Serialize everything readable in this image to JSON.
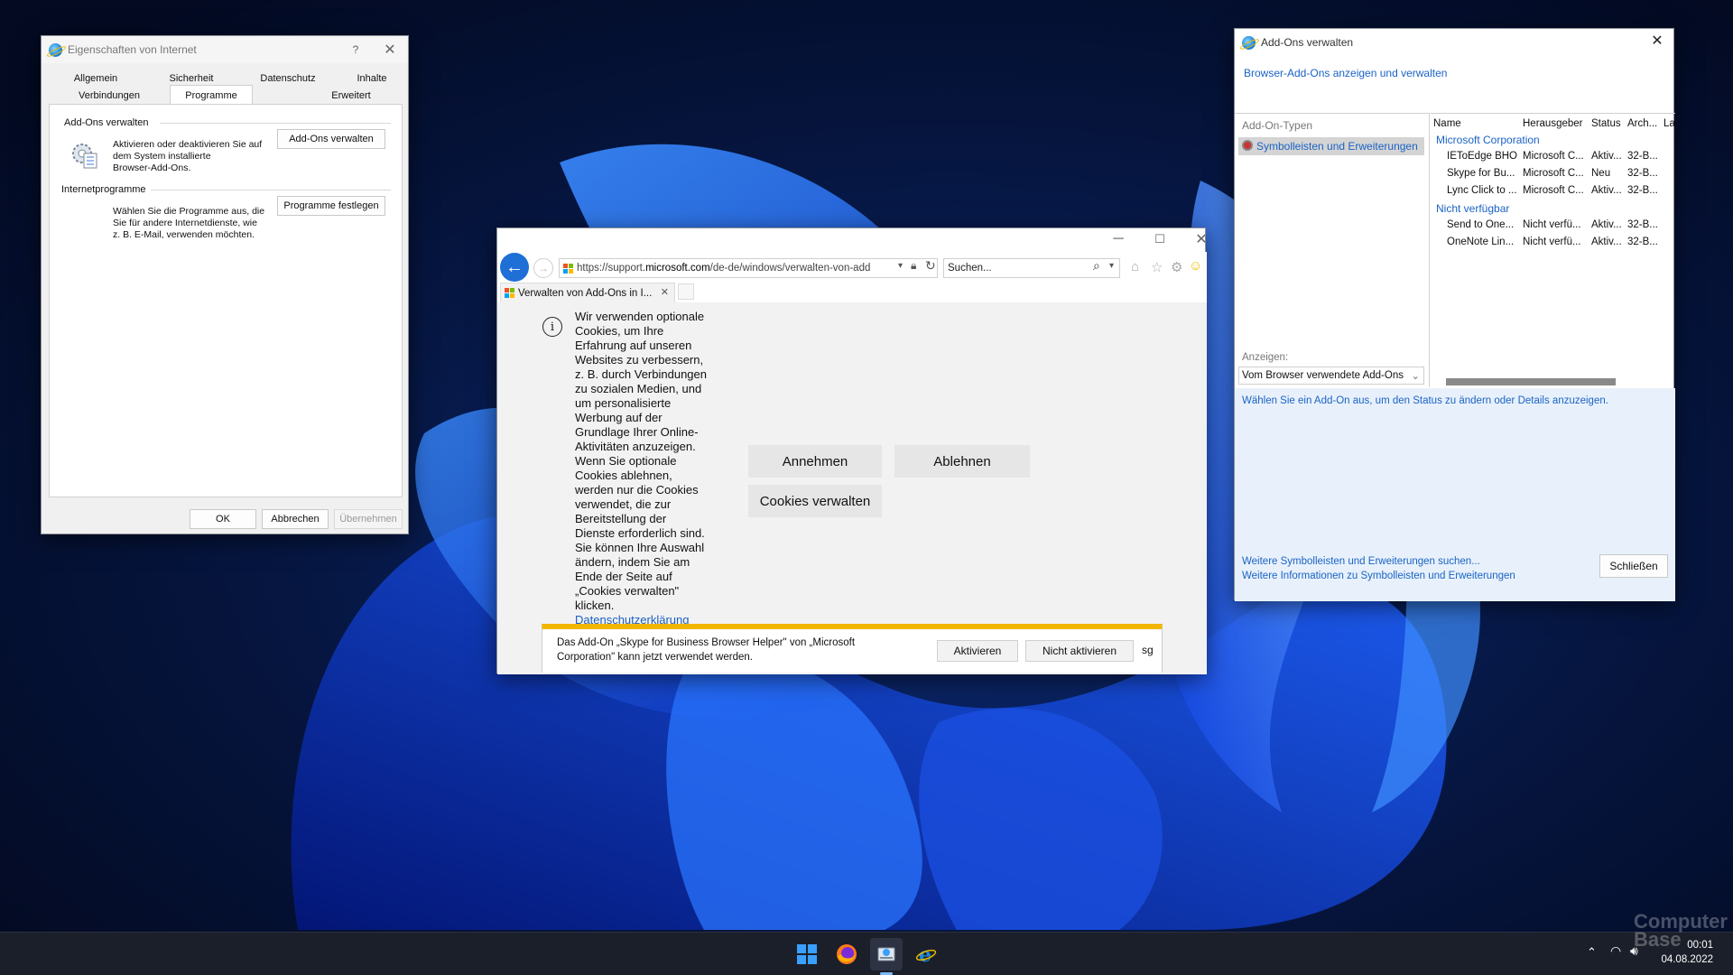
{
  "inet_options": {
    "title": "Eigenschaften von Internet",
    "help": "?",
    "tabs_row1": [
      "Allgemein",
      "Sicherheit",
      "Datenschutz",
      "Inhalte"
    ],
    "tabs_row2": [
      "Verbindungen",
      "Programme",
      "Erweitert"
    ],
    "active_tab": "Programme",
    "addons_group": "Add-Ons verwalten",
    "addons_desc_1": "Aktivieren oder deaktivieren Sie auf",
    "addons_desc_2": "dem System installierte",
    "addons_desc_3": "Browser-Add-Ons.",
    "addons_button": "Add-Ons verwalten",
    "programs_group": "Internetprogramme",
    "programs_desc_1": "Wählen Sie die Programme aus, die",
    "programs_desc_2": "Sie für andere Internetdienste, wie",
    "programs_desc_3": "z. B. E-Mail, verwenden möchten.",
    "programs_button": "Programme festlegen",
    "ok": "OK",
    "cancel": "Abbrechen",
    "apply": "Übernehmen"
  },
  "browser": {
    "url_prefix": "https://support.",
    "url_domain": "microsoft.com",
    "url_suffix": "/de-de/windows/verwalten-von-add",
    "search_placeholder": "Suchen...",
    "tab_title": "Verwalten von Add-Ons in I...",
    "cookie_lines": [
      "Wir verwenden optionale",
      "Cookies, um Ihre",
      "Erfahrung auf unseren",
      "Websites zu verbessern,",
      "z. B. durch Verbindungen",
      "zu sozialen Medien, und",
      "um personalisierte",
      "Werbung auf der",
      "Grundlage Ihrer Online-",
      "Aktivitäten anzuzeigen.",
      "Wenn Sie optionale",
      "Cookies ablehnen,",
      "werden nur die Cookies",
      "verwendet, die zur",
      "Bereitstellung der",
      "Dienste erforderlich sind.",
      "Sie können Ihre Auswahl",
      "ändern, indem Sie am",
      "Ende der Seite auf",
      "„Cookies verwalten\"",
      "klicken."
    ],
    "privacy_link": "Datenschutzerklärung",
    "accept": "Annehmen",
    "reject": "Ablehnen",
    "manage_cookies": "Cookies verwalten",
    "notif_line1": "Das Add-On „Skype for Business Browser Helper\" von „Microsoft",
    "notif_line2": "Corporation\" kann jetzt verwendet werden.",
    "notif_activate": "Aktivieren",
    "notif_dont": "Nicht aktivieren",
    "notif_overflow": "sg"
  },
  "addons": {
    "title": "Add-Ons verwalten",
    "subtitle_link": "Browser-Add-Ons anzeigen und verwalten",
    "types_label": "Add-On-Typen",
    "selected_type": "Symbolleisten und Erweiterungen",
    "show_label": "Anzeigen:",
    "show_value": "Vom Browser verwendete Add-Ons",
    "columns": [
      "Name",
      "Herausgeber",
      "Status",
      "Arch...",
      "La"
    ],
    "group1": "Microsoft Corporation",
    "group2": "Nicht verfügbar",
    "rows_g1": [
      [
        "IEToEdge BHO",
        "Microsoft C...",
        "Aktiv...",
        "32-B..."
      ],
      [
        "Skype for Bu...",
        "Microsoft C...",
        "Neu",
        "32-B..."
      ],
      [
        "Lync Click to ...",
        "Microsoft C...",
        "Aktiv...",
        "32-B..."
      ]
    ],
    "rows_g2": [
      [
        "Send to One...",
        "Nicht verfü...",
        "Aktiv...",
        "32-B..."
      ],
      [
        "OneNote Lin...",
        "Nicht verfü...",
        "Aktiv...",
        "32-B..."
      ]
    ],
    "details_hint": "Wählen Sie ein Add-On aus, um den Status zu ändern oder Details anzuzeigen.",
    "footer_link1": "Weitere Symbolleisten und Erweiterungen suchen...",
    "footer_link2": "Weitere Informationen zu Symbolleisten und Erweiterungen",
    "close_button": "Schließen"
  },
  "taskbar": {
    "time": "00:01",
    "date": "04.08.2022",
    "watermark": "Computer Base"
  }
}
